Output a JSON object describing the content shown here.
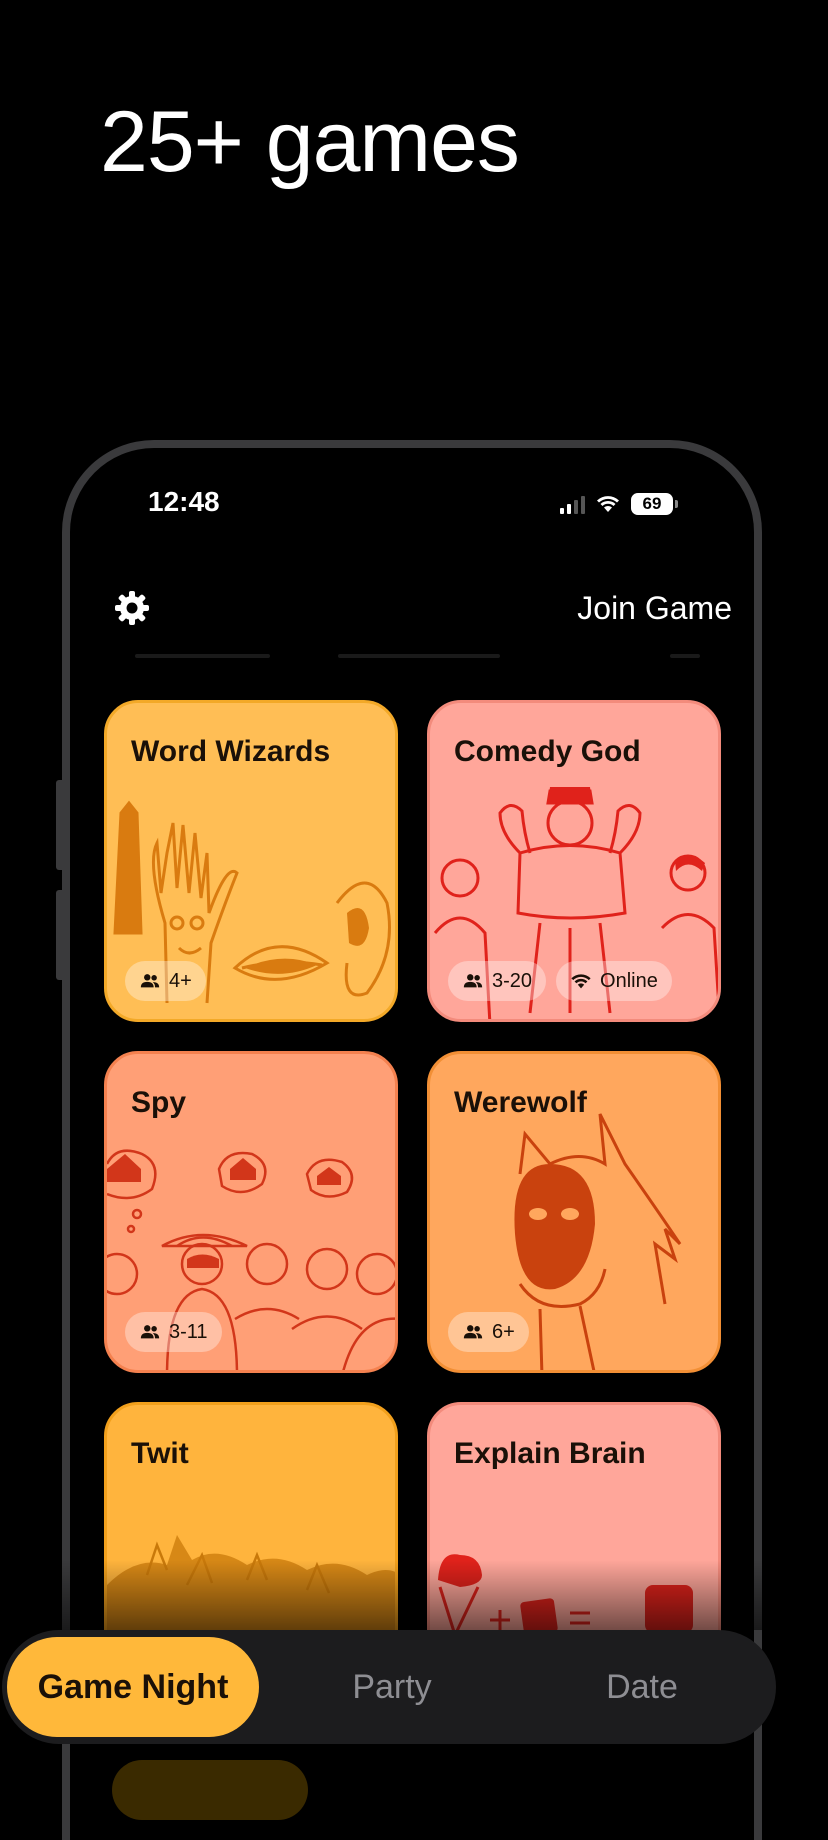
{
  "headline": "25+ games",
  "status": {
    "time": "12:48",
    "battery": "69"
  },
  "header": {
    "settings_icon": "gear-icon",
    "join_label": "Join Game"
  },
  "games": [
    {
      "title": "Word Wizards",
      "players": "4+",
      "online": null,
      "color": "#ffbe55",
      "border": "#f3a928",
      "art_color": "#d97b10"
    },
    {
      "title": "Comedy God",
      "players": "3-20",
      "online": "Online",
      "color": "#ffa69a",
      "border": "#f38b7c",
      "art_color": "#e0221b"
    },
    {
      "title": "Spy",
      "players": "3-11",
      "online": null,
      "color": "#ff9f76",
      "border": "#f4814f",
      "art_color": "#d2361a"
    },
    {
      "title": "Werewolf",
      "players": "6+",
      "online": null,
      "color": "#ffa75d",
      "border": "#f28f35",
      "art_color": "#c9420e"
    },
    {
      "title": "Twit",
      "players": null,
      "online": null,
      "color": "#ffb43d",
      "border": "#f2a01c",
      "art_color": "#c9790a"
    },
    {
      "title": "Explain Brain",
      "players": null,
      "online": null,
      "color": "#ffa69a",
      "border": "#f38b7c",
      "art_color": "#e0221b"
    }
  ],
  "tabs": [
    {
      "label": "Game Night",
      "active": true
    },
    {
      "label": "Party",
      "active": false
    },
    {
      "label": "Date",
      "active": false
    }
  ],
  "icons": {
    "players": "people-icon",
    "online": "wifi-icon"
  }
}
